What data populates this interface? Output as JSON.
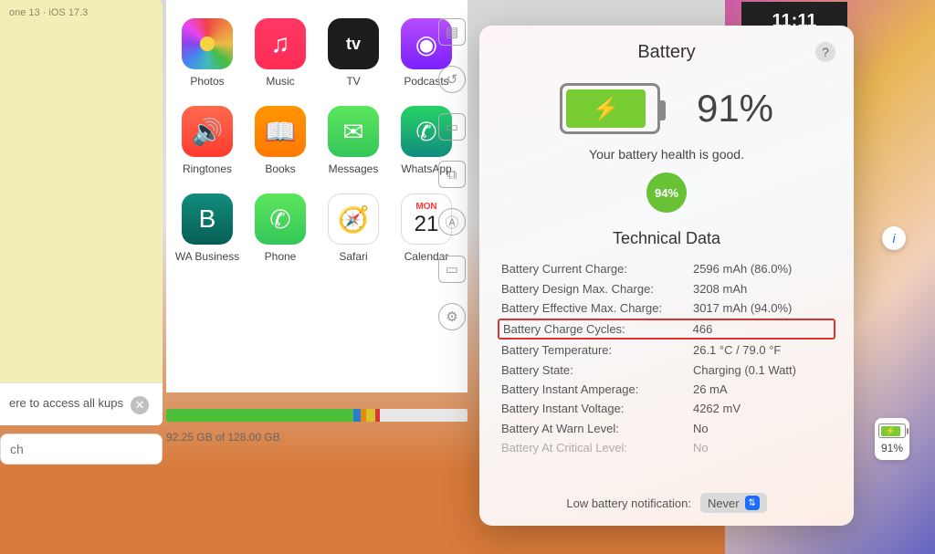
{
  "left": {
    "top_tag": "one 13 · iOS 17.3",
    "backup_text": "ere to access all\nkups",
    "search_placeholder": "ch"
  },
  "apps": [
    {
      "id": "photos",
      "label": "Photos",
      "glyph": ""
    },
    {
      "id": "music",
      "label": "Music",
      "glyph": "♫"
    },
    {
      "id": "tv",
      "label": "TV",
      "glyph": "tv"
    },
    {
      "id": "podcasts",
      "label": "Podcasts",
      "glyph": "◉"
    },
    {
      "id": "ringtones",
      "label": "Ringtones",
      "glyph": "🔊"
    },
    {
      "id": "books",
      "label": "Books",
      "glyph": "📖"
    },
    {
      "id": "messages",
      "label": "Messages",
      "glyph": "✉"
    },
    {
      "id": "whatsapp",
      "label": "WhatsApp",
      "glyph": "✆"
    },
    {
      "id": "wabiz",
      "label": "WA Business",
      "glyph": "B"
    },
    {
      "id": "phone",
      "label": "Phone",
      "glyph": "✆"
    },
    {
      "id": "safari",
      "label": "Safari",
      "glyph": "🧭"
    },
    {
      "id": "calendar",
      "label": "Calendar",
      "glyph": ""
    }
  ],
  "calendar": {
    "mon": "MON",
    "day": "21"
  },
  "storage": {
    "label": "92.25 GB of 128.00 GB",
    "segments": [
      {
        "cls": "sb-g",
        "pct": 62
      },
      {
        "cls": "sb-b",
        "pct": 2.5
      },
      {
        "cls": "sb-o",
        "pct": 2
      },
      {
        "cls": "sb-y",
        "pct": 3
      },
      {
        "cls": "sb-r",
        "pct": 1.5
      }
    ]
  },
  "battery": {
    "title": "Battery",
    "help": "?",
    "fill_pct": 91,
    "percent": "91%",
    "health_msg": "Your battery health is good.",
    "health_badge": "94%",
    "tech_title": "Technical Data",
    "rows": [
      {
        "k": "Battery Current Charge:",
        "v": "2596 mAh (86.0%)",
        "hl": false
      },
      {
        "k": "Battery Design Max. Charge:",
        "v": "3208 mAh",
        "hl": false
      },
      {
        "k": "Battery Effective Max. Charge:",
        "v": "3017 mAh (94.0%)",
        "hl": false
      },
      {
        "k": "Battery Charge Cycles:",
        "v": "466",
        "hl": true
      },
      {
        "k": "Battery Temperature:",
        "v": "26.1 °C / 79.0 °F",
        "hl": false
      },
      {
        "k": "Battery State:",
        "v": "Charging (0.1 Watt)",
        "hl": false
      },
      {
        "k": "Battery Instant Amperage:",
        "v": "26 mA",
        "hl": false
      },
      {
        "k": "Battery Instant Voltage:",
        "v": "4262 mV",
        "hl": false
      },
      {
        "k": "Battery At Warn Level:",
        "v": "No",
        "hl": false
      },
      {
        "k": "Battery At Critical Level:",
        "v": "No",
        "hl": false,
        "fade": true
      }
    ],
    "low_label": "Low battery notification:",
    "low_value": "Never"
  },
  "menubar": {
    "percent": "91%"
  },
  "phone_time": "11:11"
}
